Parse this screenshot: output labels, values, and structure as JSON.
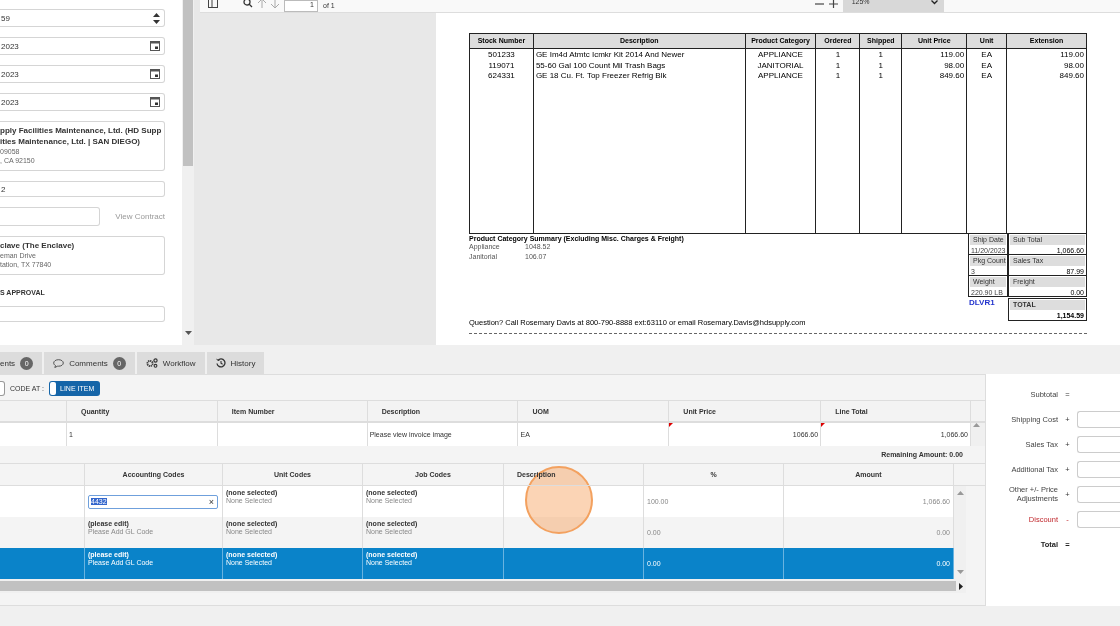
{
  "form": {
    "items": [
      {
        "kind": "spinner",
        "value": "59"
      },
      {
        "kind": "date",
        "value": "2023"
      },
      {
        "kind": "date",
        "value": "2023"
      },
      {
        "kind": "date",
        "value": "2023"
      },
      {
        "kind": "address",
        "bold": [
          "pply Facilities Maintenance, Ltd. (HD Supp",
          "ities Maintenance, Ltd. | SAN DIEGO)"
        ],
        "lines": [
          "09058",
          ", CA 92150"
        ]
      },
      {
        "kind": "text",
        "value": "2"
      },
      {
        "kind": "contract",
        "link": "View Contract"
      },
      {
        "kind": "address",
        "bold": [
          "clave (The Enclave)"
        ],
        "lines": [
          "eman Drive",
          "tation, TX 77840"
        ]
      },
      {
        "kind": "label",
        "value": "S APPROVAL"
      },
      {
        "kind": "text",
        "value": ""
      }
    ]
  },
  "viewer": {
    "page": "1",
    "of": "of 1",
    "zoom": "125%"
  },
  "invoice": {
    "columns": [
      "Stock Number",
      "Description",
      "Product Category",
      "Ordered",
      "Shipped",
      "Unit Price",
      "Unit",
      "Extension"
    ],
    "rows": [
      [
        "501233",
        "GE Im4d Atmtc Icmkr Kit 2014 And Newer",
        "APPLIANCE",
        "1",
        "1",
        "119.00",
        "EA",
        "119.00"
      ],
      [
        "119071",
        "55-60 Gal 100 Count Mil Trash Bags",
        "JANITORIAL",
        "1",
        "1",
        "98.00",
        "EA",
        "98.00"
      ],
      [
        "624331",
        "GE 18 Cu. Ft. Top Freezer Refrig Blk",
        "APPLIANCE",
        "1",
        "1",
        "849.60",
        "EA",
        "849.60"
      ]
    ],
    "summary_title": "Product Category Summary (Excluding Misc. Charges & Freight)",
    "summary": [
      {
        "name": "Appliance",
        "value": "1048.52"
      },
      {
        "name": "Janitorial",
        "value": "106.07"
      }
    ],
    "ship_info": [
      {
        "label": "Ship Date",
        "value": "11/20/2023"
      },
      {
        "label": "Pkg Count",
        "value": "3"
      },
      {
        "label": "Weight",
        "value": "220.90 LB"
      }
    ],
    "route": "DLVR1",
    "totals": [
      {
        "label": "Sub Total",
        "value": "1,066.60"
      },
      {
        "label": "Sales Tax",
        "value": "87.99"
      },
      {
        "label": "Freight",
        "value": "0.00"
      },
      {
        "label": "TOTAL",
        "value": "1,154.59"
      }
    ],
    "footer": "Question? Call Rosemary Davis at 800-790-8888 ext:63110 or email Rosemary.Davis@hdsupply.com"
  },
  "tabs": [
    {
      "label": "ents",
      "badge": "0",
      "kind": "plain",
      "selected": false
    },
    {
      "label": "Comments",
      "badge": "0",
      "kind": "comments",
      "selected": false
    },
    {
      "label": "Workflow",
      "kind": "workflow",
      "selected": false
    },
    {
      "label": "History",
      "kind": "history",
      "selected": false
    }
  ],
  "code_at": {
    "label": "CODE AT :",
    "toggle": "LINE ITEM",
    "on": true
  },
  "lines": {
    "columns": [
      "",
      "Quantity",
      "Item Number",
      "Description",
      "UOM",
      "Unit Price",
      "Line Total"
    ],
    "rows": [
      [
        {
          "text": "",
          "flagged": false
        },
        {
          "text": "1",
          "flagged": false
        },
        {
          "text": "",
          "flagged": false
        },
        {
          "text": "Please view invoice image",
          "flagged": false
        },
        {
          "text": "EA",
          "flagged": false
        },
        {
          "text": "1066.60",
          "flagged": true
        },
        {
          "text": "1,066.60",
          "flagged": true
        }
      ]
    ]
  },
  "remaining": "Remaining Amount: 0.00",
  "coding": {
    "columns": [
      "",
      "Accounting Codes",
      "Unit Codes",
      "Job Codes",
      "Description",
      "%",
      "Amount"
    ],
    "rows": [
      {
        "selected": false,
        "account": {
          "kind": "input",
          "value": "4432",
          "clear": "×"
        },
        "unit": [
          "(none selected)",
          "None Selected"
        ],
        "job": [
          "(none selected)",
          "None Selected"
        ],
        "description": "",
        "percent": "100.00",
        "amount": "1,066.60"
      },
      {
        "selected": false,
        "account": {
          "kind": "text",
          "top": "(please edit)",
          "bottom": "Please Add GL Code"
        },
        "unit": [
          "(none selected)",
          "None Selected"
        ],
        "job": [
          "(none selected)",
          "None Selected"
        ],
        "description": "",
        "percent": "0.00",
        "amount": "0.00"
      },
      {
        "selected": true,
        "account": {
          "kind": "text",
          "top": "(please edit)",
          "bottom": "Please Add GL Code"
        },
        "unit": [
          "(none selected)",
          "None Selected"
        ],
        "job": [
          "(none selected)",
          "None Selected"
        ],
        "description": "",
        "percent": "0.00",
        "amount": "0.00"
      }
    ]
  },
  "summary_panel": [
    {
      "label": "Subtotal",
      "sign": "=",
      "kind": "value",
      "red": false,
      "bold": false
    },
    {
      "label": "Shipping Cost",
      "sign": "+",
      "kind": "field",
      "red": false,
      "bold": false
    },
    {
      "label": "Sales Tax",
      "sign": "+",
      "kind": "field",
      "red": false,
      "bold": false
    },
    {
      "label": "Additional Tax",
      "sign": "+",
      "kind": "field",
      "red": false,
      "bold": false
    },
    {
      "label": "Other +/- Price Adjustments",
      "sign": "+",
      "kind": "field",
      "red": false,
      "bold": false
    },
    {
      "label": "Discount",
      "sign": "-",
      "kind": "field",
      "red": true,
      "bold": false
    },
    {
      "label": "Total",
      "sign": "=",
      "kind": "value",
      "red": false,
      "bold": true
    }
  ]
}
